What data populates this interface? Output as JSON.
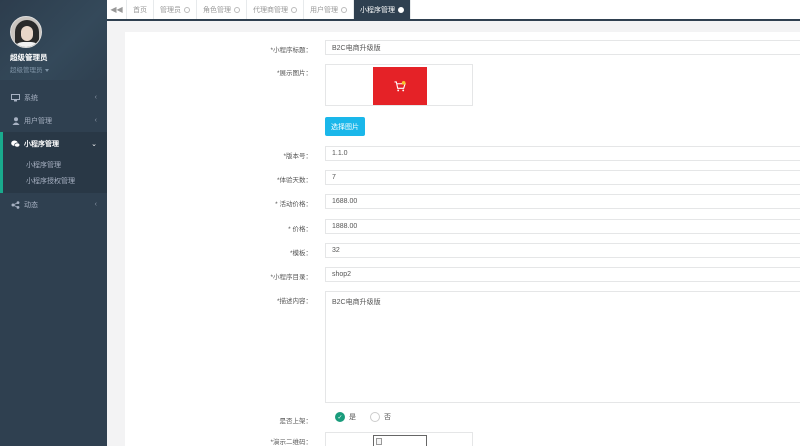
{
  "sidebar": {
    "user_name": "超级管理员",
    "user_role": "超级管理员",
    "items": [
      {
        "label": "系统",
        "icon": "monitor-icon"
      },
      {
        "label": "用户管理",
        "icon": "user-icon"
      },
      {
        "label": "小程序管理",
        "icon": "wechat-icon"
      },
      {
        "label": "动态",
        "icon": "share-icon"
      }
    ],
    "subitems": [
      "小程序管理",
      "小程序授权管理"
    ]
  },
  "tabs": {
    "back": "◀◀",
    "items": [
      "首页",
      "管理员",
      "角色管理",
      "代理商管理",
      "用户管理",
      "小程序管理"
    ]
  },
  "form": {
    "title_label": "*小程序标题：",
    "title_value": "B2C电商升级版",
    "image_label": "*展示图片：",
    "select_image_button": "选择图片",
    "version_label": "*版本号：",
    "version_value": "1.1.0",
    "trial_label": "*体验天数：",
    "trial_value": "7",
    "promo_price_label": "* 活动价格：",
    "promo_price_value": "1688.00",
    "price_label": "* 价格：",
    "price_value": "1888.00",
    "template_label": "*模板：",
    "template_value": "32",
    "dir_label": "*小程序目录：",
    "dir_value": "shop2",
    "desc_label": "*描述内容：",
    "desc_value": "B2C电商升级版",
    "listed_label": "是否上架：",
    "listed_yes": "是",
    "listed_no": "否",
    "qr_label": "*演示二维码："
  },
  "colors": {
    "sidebar_bg": "#2f4050",
    "accent_green": "#19aa8d",
    "button_blue": "#1ab7ea",
    "thumb_red": "#e52227"
  }
}
